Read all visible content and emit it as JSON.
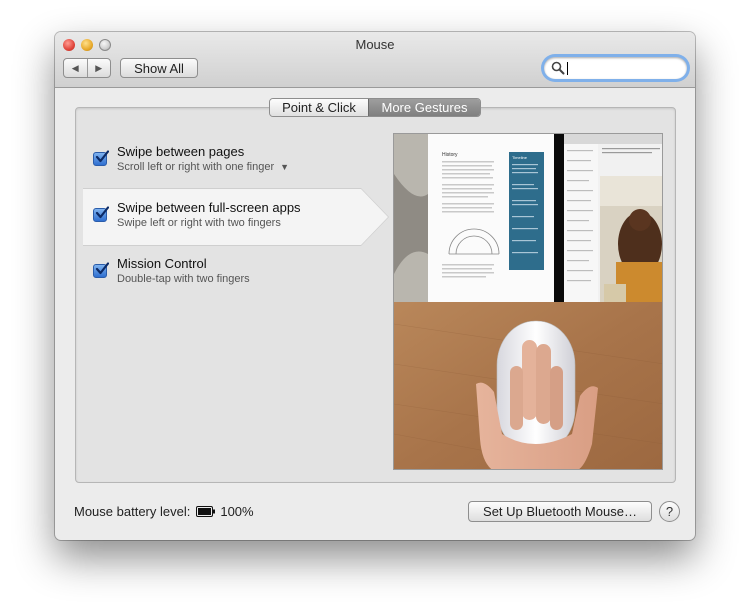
{
  "window": {
    "title": "Mouse",
    "show_all_label": "Show All",
    "back_glyph": "◀",
    "forward_glyph": "▶",
    "search_placeholder": ""
  },
  "tabs": [
    {
      "label": "Point & Click",
      "selected": false
    },
    {
      "label": "More Gestures",
      "selected": true
    }
  ],
  "options": [
    {
      "title": "Swipe between pages",
      "subtitle": "Scroll left or right with one finger",
      "checked": true,
      "has_dropdown": true
    },
    {
      "title": "Swipe between full-screen apps",
      "subtitle": "Swipe left or right with two fingers",
      "checked": true,
      "selected": true
    },
    {
      "title": "Mission Control",
      "subtitle": "Double-tap with two fingers",
      "checked": true
    }
  ],
  "preview": {
    "doc_heading": "History",
    "sidebar_title": "Timeline"
  },
  "footer": {
    "battery_label": "Mouse battery level:",
    "battery_value": "100%",
    "bluetooth_button": "Set Up Bluetooth Mouse…",
    "help_glyph": "?"
  },
  "colors": {
    "accent": "#3b7de0",
    "selected_tab": "#8a8a8a",
    "window_bg": "#ececec"
  },
  "icons": [
    "back-icon",
    "forward-icon",
    "search-icon",
    "checkbox-checked-icon",
    "chevron-down-icon",
    "battery-icon",
    "help-icon"
  ]
}
